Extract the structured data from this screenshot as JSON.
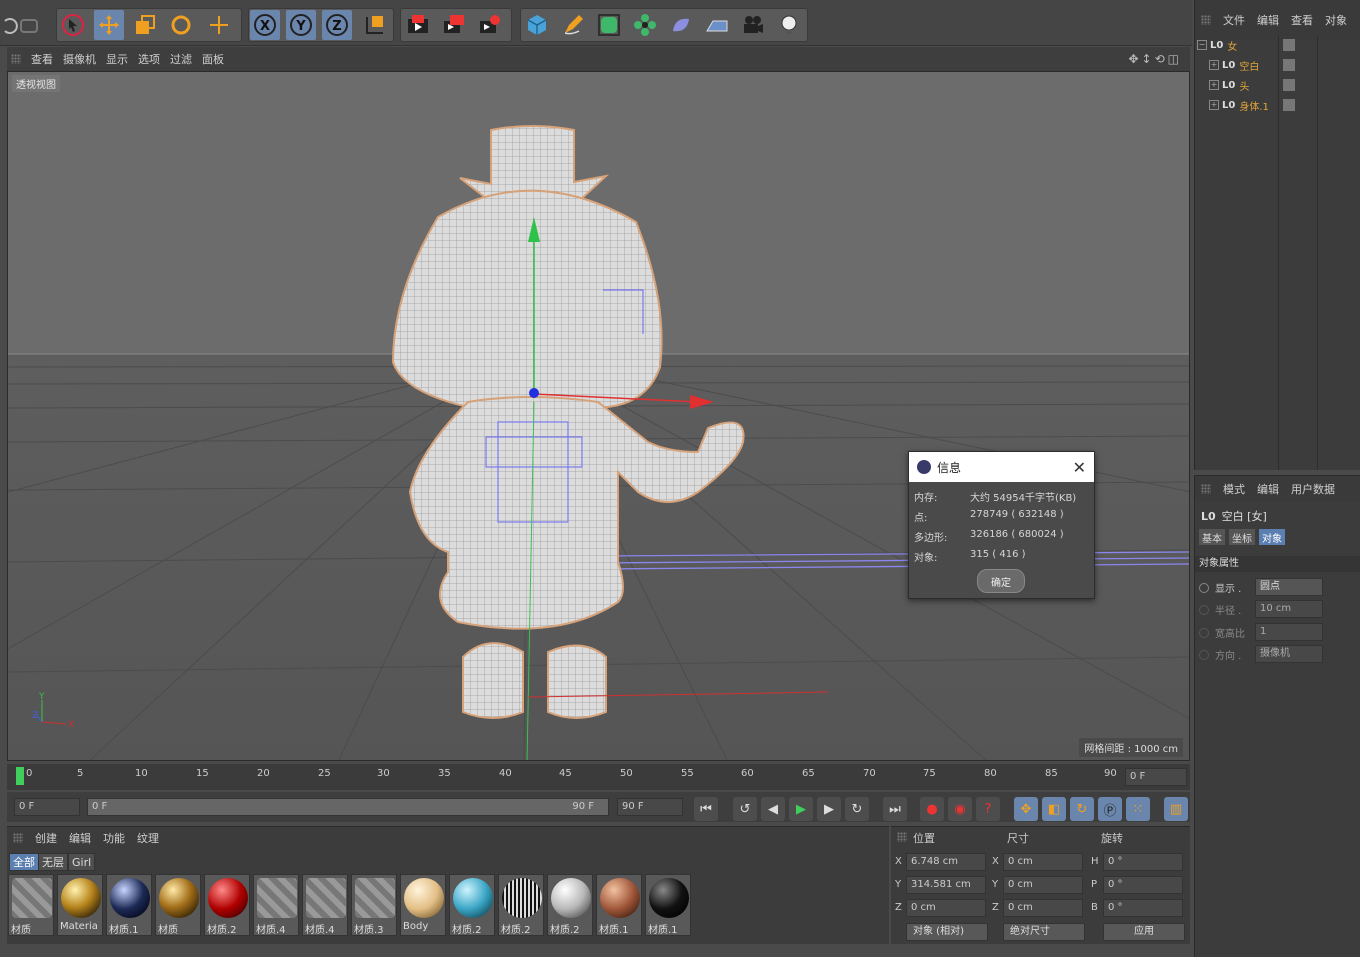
{
  "vp_menu": [
    "查看",
    "摄像机",
    "显示",
    "选项",
    "过滤",
    "面板"
  ],
  "viewport": {
    "label": "透视视图",
    "grid_spacing": "网格间距 : 1000 cm"
  },
  "dialog": {
    "title": "信息",
    "rows": [
      {
        "label": "内存:",
        "value": "大约 54954千字节(KB)"
      },
      {
        "label": "点:",
        "value": "278749 ( 632148 )"
      },
      {
        "label": "多边形:",
        "value": "326186 ( 680024 )"
      },
      {
        "label": "对象:",
        "value": "315 ( 416 )"
      }
    ],
    "ok": "确定"
  },
  "object_panel": {
    "menu": [
      "文件",
      "编辑",
      "查看",
      "对象"
    ],
    "items": [
      "女",
      "空白",
      "头",
      "身体.1"
    ],
    "accent": "#e2a53a"
  },
  "attr_panel": {
    "menu": [
      "模式",
      "编辑",
      "用户数据"
    ],
    "object_name": "空白 [女]",
    "tabs": [
      "基本",
      "坐标",
      "对象"
    ],
    "section": "对象属性",
    "rows": [
      {
        "label": "显示 .",
        "value": "圆点"
      },
      {
        "label": "半径 .",
        "value": "10 cm"
      },
      {
        "label": "宽高比",
        "value": "1"
      },
      {
        "label": "方向 .",
        "value": "摄像机"
      }
    ]
  },
  "timeline": {
    "ticks": [
      "0",
      "5",
      "10",
      "15",
      "20",
      "25",
      "30",
      "35",
      "40",
      "45",
      "50",
      "55",
      "60",
      "65",
      "70",
      "75",
      "80",
      "85",
      "90"
    ],
    "current": "0 F",
    "start": "0 F",
    "range_start": "0 F",
    "range_end": "90 F",
    "end": "90 F"
  },
  "material_panel": {
    "menu": [
      "创建",
      "编辑",
      "功能",
      "纹理"
    ],
    "tabs": [
      "全部",
      "无层",
      "Girl"
    ],
    "materials": [
      "材质",
      "Materia",
      "材质.1",
      "材质",
      "材质.2",
      "材质.4",
      "材质.4",
      "材质.3",
      "Body",
      "材质.2",
      "材质.2",
      "材质.2",
      "材质.1",
      "材质.1"
    ]
  },
  "coord_panel": {
    "headers": [
      "位置",
      "尺寸",
      "旋转"
    ],
    "position": {
      "x": "6.748 cm",
      "y": "314.581 cm",
      "z": "0 cm"
    },
    "size": {
      "x": "0 cm",
      "y": "0 cm",
      "z": "0 cm"
    },
    "rotation": {
      "h": "0 °",
      "p": "0 °",
      "b": "0 °"
    },
    "axis_x": "X",
    "axis_y": "Y",
    "axis_z": "Z",
    "axis_h": "H",
    "axis_p": "P",
    "axis_b": "B",
    "mode": "对象 (相对)",
    "size_mode": "绝对尺寸",
    "apply": "应用"
  },
  "toolbar_icons": [
    "undo-icon",
    "redo-icon",
    "select-arrow-icon",
    "move-icon",
    "scale-icon",
    "rotate-icon",
    "move-plus-icon",
    "x-axis-icon",
    "y-axis-icon",
    "z-axis-icon",
    "coordinate-system-icon",
    "render-view-icon",
    "render-picture-icon",
    "render-settings-icon",
    "cube-icon",
    "pen-icon",
    "subdivision-icon",
    "cloner-icon",
    "deformer-icon",
    "floor-icon",
    "camera-icon",
    "light-icon"
  ]
}
